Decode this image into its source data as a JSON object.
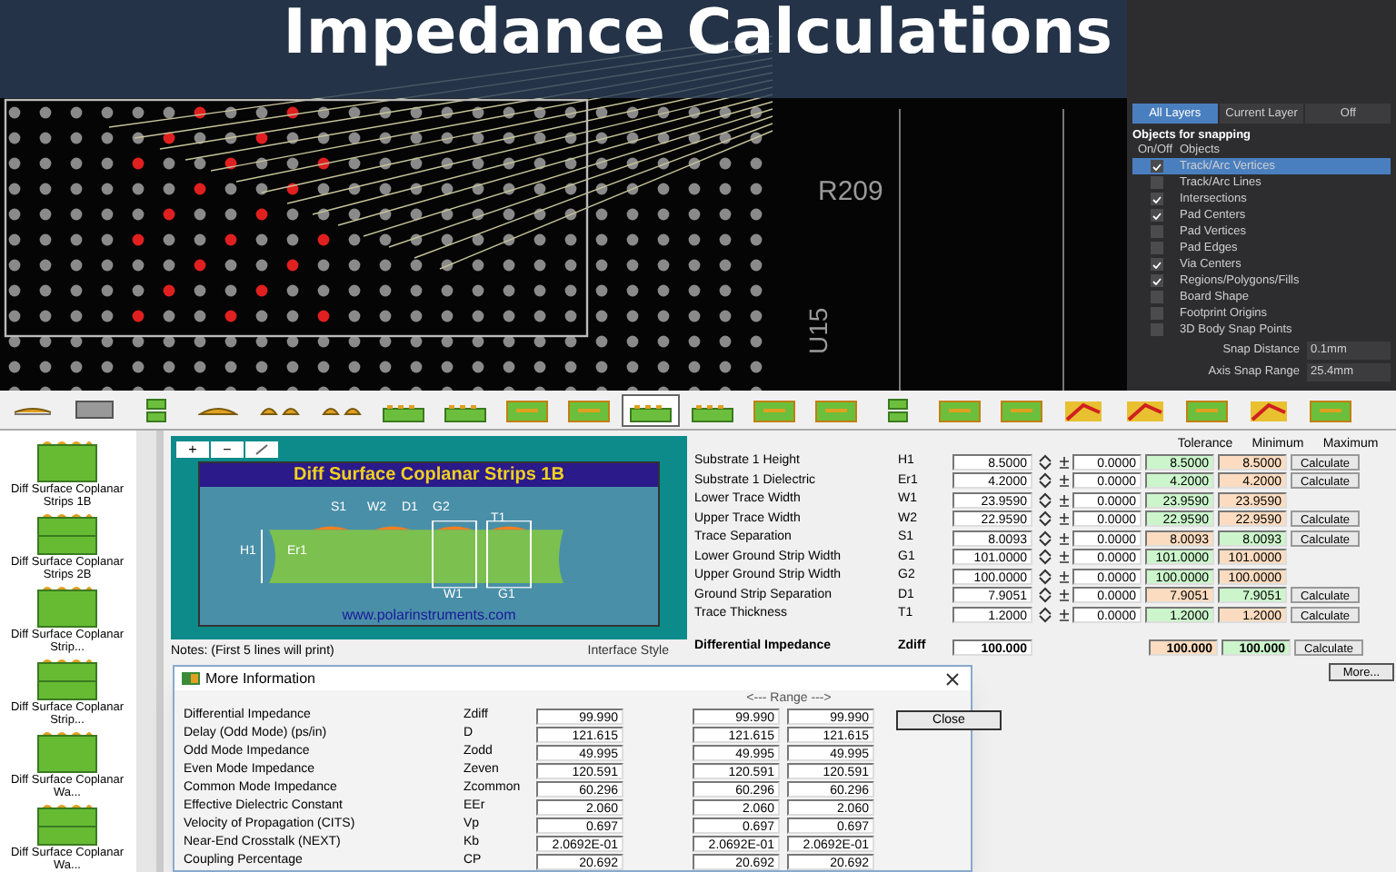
{
  "banner": {
    "title": "Impedance Calculations"
  },
  "board": {
    "labels": [
      "R209",
      "U15"
    ]
  },
  "snap_panel": {
    "tabs": [
      {
        "label": "All Layers",
        "selected": true
      },
      {
        "label": "Current Layer",
        "selected": false
      },
      {
        "label": "Off",
        "selected": false
      }
    ],
    "heading": "Objects for snapping",
    "columns": [
      "On/Off",
      "Objects"
    ],
    "objects": [
      {
        "name": "Track/Arc Vertices",
        "checked": true,
        "selected": true
      },
      {
        "name": "Track/Arc Lines",
        "checked": false,
        "selected": false
      },
      {
        "name": "Intersections",
        "checked": true,
        "selected": false
      },
      {
        "name": "Pad Centers",
        "checked": true,
        "selected": false
      },
      {
        "name": "Pad Vertices",
        "checked": false,
        "selected": false
      },
      {
        "name": "Pad Edges",
        "checked": false,
        "selected": false
      },
      {
        "name": "Via Centers",
        "checked": true,
        "selected": false
      },
      {
        "name": "Regions/Polygons/Fills",
        "checked": true,
        "selected": false
      },
      {
        "name": "Board Shape",
        "checked": false,
        "selected": false
      },
      {
        "name": "Footprint Origins",
        "checked": false,
        "selected": false
      },
      {
        "name": "3D Body Snap Points",
        "checked": false,
        "selected": false
      }
    ],
    "settings": [
      {
        "label": "Snap Distance",
        "value": "0.1mm"
      },
      {
        "label": "Axis Snap Range",
        "value": "25.4mm"
      }
    ]
  },
  "toolbar": [
    {
      "kind": "surface",
      "selected": false
    },
    {
      "kind": "box",
      "selected": false
    },
    {
      "kind": "stack",
      "selected": false
    },
    {
      "kind": "strip",
      "selected": false
    },
    {
      "kind": "pair",
      "selected": false
    },
    {
      "kind": "pair",
      "selected": false
    },
    {
      "kind": "coplanar",
      "selected": false
    },
    {
      "kind": "coplanar",
      "selected": false
    },
    {
      "kind": "embedded",
      "selected": false
    },
    {
      "kind": "embedded",
      "selected": false
    },
    {
      "kind": "coplanar",
      "selected": true
    },
    {
      "kind": "coplanar",
      "selected": false
    },
    {
      "kind": "embedded",
      "selected": false
    },
    {
      "kind": "embedded",
      "selected": false
    },
    {
      "kind": "stack",
      "selected": false
    },
    {
      "kind": "embedded",
      "selected": false
    },
    {
      "kind": "embedded",
      "selected": false
    },
    {
      "kind": "tool",
      "selected": false
    },
    {
      "kind": "tool",
      "selected": false
    },
    {
      "kind": "embedded",
      "selected": false
    },
    {
      "kind": "tool",
      "selected": false
    },
    {
      "kind": "embedded",
      "selected": false
    }
  ],
  "structures": [
    {
      "label": "Diff Surface Coplanar Strips 1B",
      "kind": "single"
    },
    {
      "label": "Diff Surface Coplanar Strips 2B",
      "kind": "double"
    },
    {
      "label": "Diff Surface Coplanar Strip...",
      "kind": "single"
    },
    {
      "label": "Diff Surface Coplanar Strip...",
      "kind": "double"
    },
    {
      "label": "Diff Surface Coplanar Wa...",
      "kind": "single"
    },
    {
      "label": "Diff Surface Coplanar Wa...",
      "kind": "double"
    }
  ],
  "diagram": {
    "tools": [
      "+",
      "−"
    ],
    "title": "Diff Surface Coplanar Strips 1B",
    "dimension_labels": [
      "S1",
      "W2",
      "D1",
      "G2",
      "T1",
      "H1",
      "Er1",
      "W1",
      "G1"
    ],
    "url": "www.polarinstruments.com"
  },
  "notes": "Notes: (First 5 lines will print)",
  "interface_style": "Interface Style",
  "parameters": {
    "columns": [
      "Tolerance",
      "Minimum",
      "Maximum"
    ],
    "rows": [
      {
        "label": "Substrate 1 Height",
        "symbol": "H1",
        "value": "8.5000",
        "tolerance": "0.0000",
        "min": {
          "value": "8.5000",
          "color": "#ccf5cc"
        },
        "max": {
          "value": "8.5000",
          "color": "#fcdcc0"
        },
        "action": "Calculate"
      },
      {
        "label": "Substrate 1 Dielectric",
        "symbol": "Er1",
        "value": "4.2000",
        "tolerance": "0.0000",
        "min": {
          "value": "4.2000",
          "color": "#ccf5cc"
        },
        "max": {
          "value": "4.2000",
          "color": "#fcdcc0"
        },
        "action": "Calculate"
      },
      {
        "label": "Lower Trace Width",
        "symbol": "W1",
        "value": "23.9590",
        "tolerance": "0.0000",
        "min": {
          "value": "23.9590",
          "color": "#ccf5cc"
        },
        "max": {
          "value": "23.9590",
          "color": "#fcdcc0"
        }
      },
      {
        "label": "Upper Trace Width",
        "symbol": "W2",
        "value": "22.9590",
        "tolerance": "0.0000",
        "min": {
          "value": "22.9590",
          "color": "#ccf5cc"
        },
        "max": {
          "value": "22.9590",
          "color": "#fcdcc0"
        },
        "action": "Calculate"
      },
      {
        "label": "Trace Separation",
        "symbol": "S1",
        "value": "8.0093",
        "tolerance": "0.0000",
        "min": {
          "value": "8.0093",
          "color": "#fcdcc0"
        },
        "max": {
          "value": "8.0093",
          "color": "#ccf5cc"
        },
        "action": "Calculate"
      },
      {
        "label": "Lower Ground Strip Width",
        "symbol": "G1",
        "value": "101.0000",
        "tolerance": "0.0000",
        "min": {
          "value": "101.0000",
          "color": "#ccf5cc"
        },
        "max": {
          "value": "101.0000",
          "color": "#fcdcc0"
        }
      },
      {
        "label": "Upper Ground Strip Width",
        "symbol": "G2",
        "value": "100.0000",
        "tolerance": "0.0000",
        "min": {
          "value": "100.0000",
          "color": "#ccf5cc"
        },
        "max": {
          "value": "100.0000",
          "color": "#fcdcc0"
        }
      },
      {
        "label": "Ground Strip Separation",
        "symbol": "D1",
        "value": "7.9051",
        "tolerance": "0.0000",
        "min": {
          "value": "7.9051",
          "color": "#fcdcc0"
        },
        "max": {
          "value": "7.9051",
          "color": "#ccf5cc"
        },
        "action": "Calculate"
      },
      {
        "label": "Trace Thickness",
        "symbol": "T1",
        "value": "1.2000",
        "tolerance": "0.0000",
        "min": {
          "value": "1.2000",
          "color": "#ccf5cc"
        },
        "max": {
          "value": "1.2000",
          "color": "#fcdcc0"
        },
        "action": "Calculate"
      }
    ],
    "result": {
      "label": "Differential Impedance",
      "symbol": "Zdiff",
      "value": "100.000",
      "min": {
        "value": "100.000",
        "color": "#fcdcc0"
      },
      "max": {
        "value": "100.000",
        "color": "#ccf5cc"
      },
      "action": "Calculate"
    },
    "more_button": "More..."
  },
  "dialog": {
    "title": "More Information",
    "range": "<--- Range --->",
    "close": "Close",
    "rows": [
      {
        "label": "Differential Impedance",
        "symbol": "Zdiff",
        "value": "99.990",
        "min": "99.990",
        "max": "99.990"
      },
      {
        "label": "Delay (Odd Mode) (ps/in)",
        "symbol": "D",
        "value": "121.615",
        "min": "121.615",
        "max": "121.615"
      },
      {
        "label": "Odd Mode Impedance",
        "symbol": "Zodd",
        "value": "49.995",
        "min": "49.995",
        "max": "49.995"
      },
      {
        "label": "Even Mode Impedance",
        "symbol": "Zeven",
        "value": "120.591",
        "min": "120.591",
        "max": "120.591"
      },
      {
        "label": "Common Mode Impedance",
        "symbol": "Zcommon",
        "value": "60.296",
        "min": "60.296",
        "max": "60.296"
      },
      {
        "label": "Effective Dielectric Constant",
        "symbol": "EEr",
        "value": "2.060",
        "min": "2.060",
        "max": "2.060"
      },
      {
        "label": "Velocity of Propagation (CITS)",
        "symbol": "Vp",
        "value": "0.697",
        "min": "0.697",
        "max": "0.697"
      },
      {
        "label": "Near-End Crosstalk (NEXT)",
        "symbol": "Kb",
        "value": "2.0692E-01",
        "min": "2.0692E-01",
        "max": "2.0692E-01"
      },
      {
        "label": "Coupling Percentage",
        "symbol": "CP",
        "value": "20.692",
        "min": "20.692",
        "max": "20.692"
      }
    ]
  }
}
